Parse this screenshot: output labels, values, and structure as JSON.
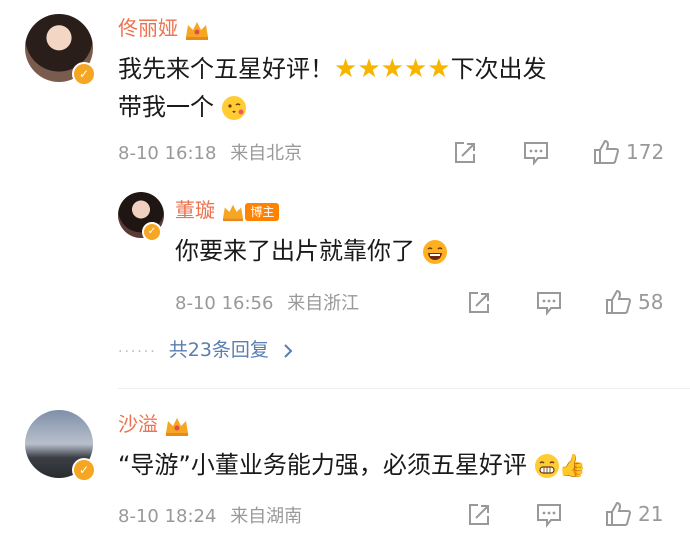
{
  "comments": [
    {
      "user": "佟丽娅",
      "text_before_stars": "我先来个五星好评！",
      "stars": 5,
      "text_after_stars": "下次出发",
      "text_line2": "带我一个",
      "time": "8-10 16:18",
      "location": "来自北京",
      "likes": "172"
    },
    {
      "user": "董璇",
      "tag": "博主",
      "text": "你要来了出片就靠你了",
      "time": "8-10 16:56",
      "location": "来自浙江",
      "likes": "58"
    },
    {
      "user": "沙溢",
      "text": "“导游”小董业务能力强，必须五星好评",
      "time": "8-10 18:24",
      "location": "来自湖南",
      "likes": "21"
    }
  ],
  "replies_link": "共23条回复",
  "colors": {
    "name": "#eb7350",
    "link": "#5b7db2",
    "star": "#f7b500",
    "vip": "#f5a623"
  },
  "icons": [
    "verified-badge-icon",
    "crown-icon",
    "share-icon",
    "comment-icon",
    "like-icon",
    "chevron-right-icon",
    "laugh-emoji-icon",
    "thumbs-up-emoji-icon"
  ]
}
